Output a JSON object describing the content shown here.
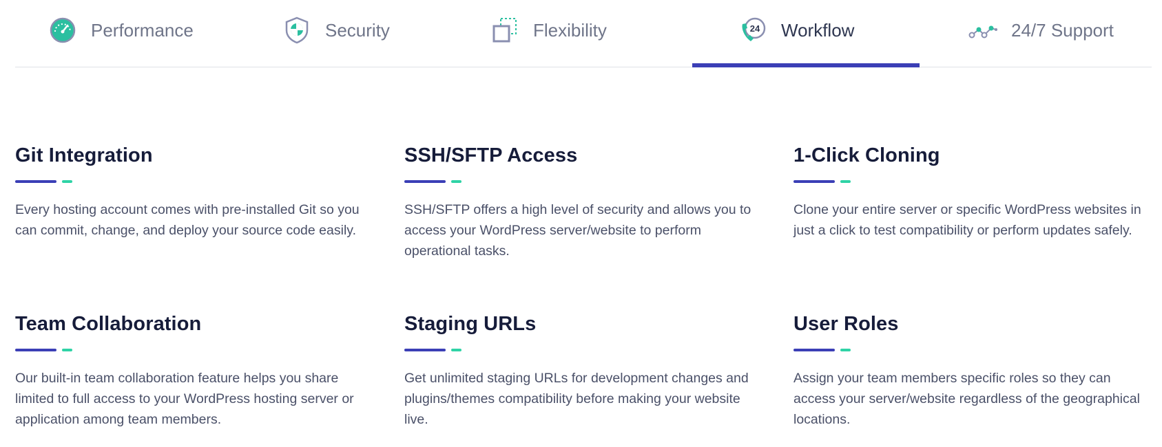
{
  "tabs": [
    {
      "label": "Performance",
      "icon": "speedometer-icon",
      "active": false
    },
    {
      "label": "Security",
      "icon": "shield-icon",
      "active": false
    },
    {
      "label": "Flexibility",
      "icon": "resize-squares-icon",
      "active": false
    },
    {
      "label": "Workflow",
      "icon": "phone-24-icon",
      "active": true
    },
    {
      "label": "24/7 Support",
      "icon": "network-nodes-icon",
      "active": false
    }
  ],
  "features": [
    {
      "title": "Git Integration",
      "description": "Every hosting account comes with pre-installed Git so you can commit, change, and deploy your source code easily."
    },
    {
      "title": "SSH/SFTP Access",
      "description": "SSH/SFTP offers a high level of security and allows you to access your WordPress server/website to perform operational tasks."
    },
    {
      "title": "1-Click Cloning",
      "description": "Clone your entire server or specific WordPress websites in just a click to test compatibility or perform updates safely."
    },
    {
      "title": "Team Collaboration",
      "description": "Our built-in team collaboration feature helps you share limited to full access to your WordPress hosting server or application among team members."
    },
    {
      "title": "Staging URLs",
      "description": "Get unlimited staging URLs for development changes and plugins/themes compatibility before making your website live."
    },
    {
      "title": "User Roles",
      "description": "Assign your team members specific roles so they can access your server/website regardless of the geographical locations."
    }
  ],
  "colors": {
    "accent_blue": "#3b3fb6",
    "accent_green": "#2fd3a6",
    "icon_purple": "#8a8fb0",
    "icon_teal": "#2bbfa0"
  }
}
